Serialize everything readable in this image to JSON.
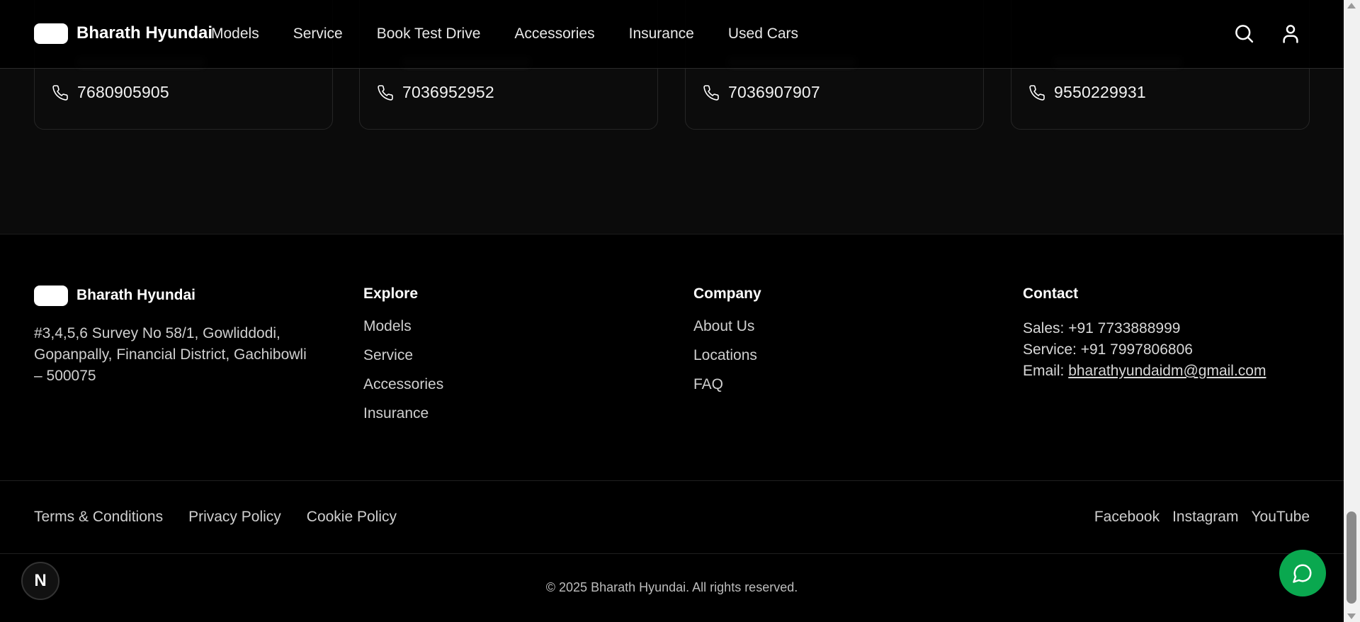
{
  "header": {
    "brand": "Bharath Hyundai",
    "nav": [
      "Models",
      "Service",
      "Book Test Drive",
      "Accessories",
      "Insurance",
      "Used Cars"
    ],
    "icons": [
      "search-icon",
      "user-icon"
    ]
  },
  "cards": [
    {
      "phone": "7680905905"
    },
    {
      "phone": "7036952952"
    },
    {
      "phone": "7036907907"
    },
    {
      "phone": "9550229931"
    }
  ],
  "footer": {
    "brand": "Bharath Hyundai",
    "address": "#3,4,5,6 Survey No 58/1, Gowliddodi, Gopanpally, Financial District, Gachibowli – 500075",
    "explore": {
      "title": "Explore",
      "links": [
        "Models",
        "Service",
        "Accessories",
        "Insurance"
      ]
    },
    "company": {
      "title": "Company",
      "links": [
        "About Us",
        "Locations",
        "FAQ"
      ]
    },
    "contact": {
      "title": "Contact",
      "sales": "Sales: +91 7733888999",
      "service": "Service: +91 7997806806",
      "email_label": "Email: ",
      "email": "bharathyundaidm@gmail.com"
    },
    "legal": [
      "Terms & Conditions",
      "Privacy Policy",
      "Cookie Policy"
    ],
    "social": [
      "Facebook",
      "Instagram",
      "YouTube"
    ],
    "copyright": "© 2025 Bharath Hyundai. All rights reserved."
  },
  "badge": "N",
  "colors": {
    "background": "#000000",
    "chat_button": "#0aa84f",
    "text": "#ffffff"
  }
}
